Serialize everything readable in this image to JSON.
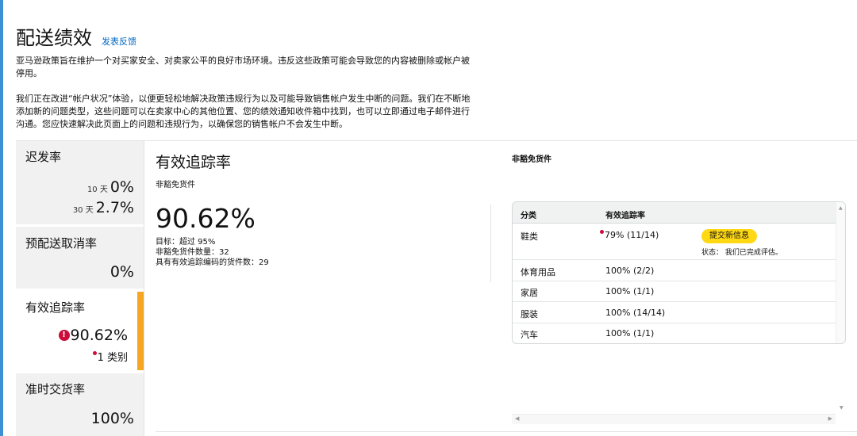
{
  "header": {
    "title": "配送绩效",
    "feedback_link": "发表反馈",
    "desc_1": "亚马逊政策旨在维护一个对买家安全、对卖家公平的良好市场环境。违反这些政策可能会导致您的内容被删除或帐户被停用。",
    "desc_2": "我们正在改进“帐户状况”体验，以便更轻松地解决政策违规行为以及可能导致销售帐户发生中断的问题。我们在不断地添加新的问题类型，这些问题可以在卖家中心的其他位置、您的绩效通知收件箱中找到，也可以立即通过电子邮件进行沟通。您应快速解决此页面上的问题和违规行为，以确保您的销售帐户不会发生中断。"
  },
  "sidebar": {
    "tiles": [
      {
        "label": "迟发率",
        "rows": [
          {
            "sub": "10 天",
            "value": "0%"
          },
          {
            "sub": "30 天",
            "value": "2.7%"
          }
        ]
      },
      {
        "label": "预配送取消率",
        "value": "0%"
      },
      {
        "label": "有效追踪率",
        "value": "90.62%",
        "note": "1 类别",
        "selected": true
      },
      {
        "label": "准时交货率",
        "value": "100%"
      }
    ]
  },
  "detail": {
    "title": "有效追踪率",
    "subtitle": "非豁免货件",
    "big_value": "90.62%",
    "stats": [
      "目标：超过 95%",
      "非豁免货件数量：32",
      "具有有效追踪编码的货件数：29"
    ],
    "right_heading": "非豁免货件"
  },
  "table": {
    "headers": [
      "分类",
      "有效追踪率"
    ],
    "rows": [
      {
        "category": "鞋类",
        "rate": "79% (11/14)",
        "flag": true,
        "button": "提交新信息",
        "status": "状态： 我们已完成评估。"
      },
      {
        "category": "体育用品",
        "rate": "100% (2/2)"
      },
      {
        "category": "家居",
        "rate": "100% (1/1)"
      },
      {
        "category": "服装",
        "rate": "100% (14/14)"
      },
      {
        "category": "汽车",
        "rate": "100% (1/1)"
      }
    ]
  },
  "colors": {
    "accent_bar": "#f5a623",
    "error": "#cc0c39",
    "button": "#ffd814",
    "link": "#0066c0",
    "tile_bg": "#f2f1f2"
  }
}
